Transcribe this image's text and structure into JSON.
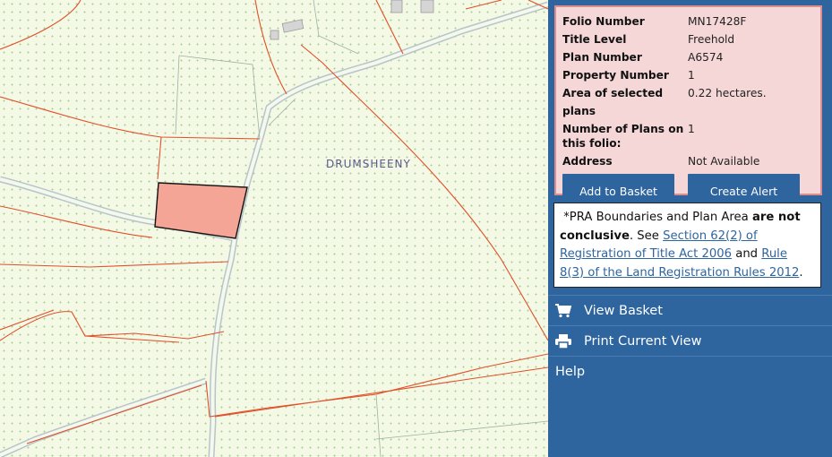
{
  "map": {
    "place_label": "DRUMSHEENY"
  },
  "info": {
    "rows": [
      {
        "label": "Folio Number",
        "value": "MN17428F"
      },
      {
        "label": "Title Level",
        "value": "Freehold"
      },
      {
        "label": "Plan Number",
        "value": "A6574"
      },
      {
        "label": "Property Number",
        "value": "1"
      },
      {
        "label": "Area of selected plans",
        "value": "0.22 hectares."
      },
      {
        "label": "Number of Plans on this folio:",
        "value": "1"
      },
      {
        "label": "Address",
        "value": "Not Available"
      }
    ],
    "add_to_basket": "Add to Basket",
    "create_alert": "Create Alert"
  },
  "disclaimer": {
    "prefix": "*PRA Boundaries and Plan Area ",
    "bold": "are not conclusive",
    "mid": ". See ",
    "link1": "Section 62(2) of Registration of Title Act 2006",
    "and": " and ",
    "link2": "Rule 8(3) of the Land Registration Rules 2012",
    "suffix": "."
  },
  "menu": {
    "view_basket": "View Basket",
    "print_view": "Print Current View",
    "help": "Help"
  },
  "colors": {
    "panel": "#2f659f",
    "info_bg": "#f6d7d7",
    "info_border": "#e08c8c",
    "parcel_fill": "#f4a595",
    "boundary": "#e0502a"
  }
}
